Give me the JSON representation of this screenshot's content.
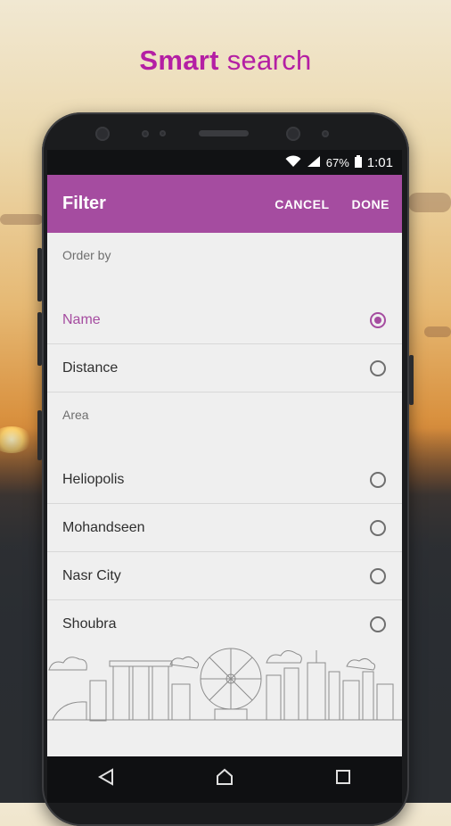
{
  "headline": {
    "bold": "Smart",
    "rest": " search"
  },
  "status_bar": {
    "battery": "67%",
    "time": "1:01"
  },
  "appbar": {
    "title": "Filter",
    "cancel": "CANCEL",
    "done": "DONE"
  },
  "order_by": {
    "label": "Order by",
    "options": [
      {
        "label": "Name",
        "selected": true
      },
      {
        "label": "Distance",
        "selected": false
      }
    ]
  },
  "area": {
    "label": "Area",
    "options": [
      {
        "label": "Heliopolis",
        "selected": false
      },
      {
        "label": "Mohandseen",
        "selected": false
      },
      {
        "label": "Nasr City",
        "selected": false
      },
      {
        "label": "Shoubra",
        "selected": false
      }
    ]
  },
  "colors": {
    "accent": "#a54ca0",
    "headline": "#b41fa4"
  }
}
